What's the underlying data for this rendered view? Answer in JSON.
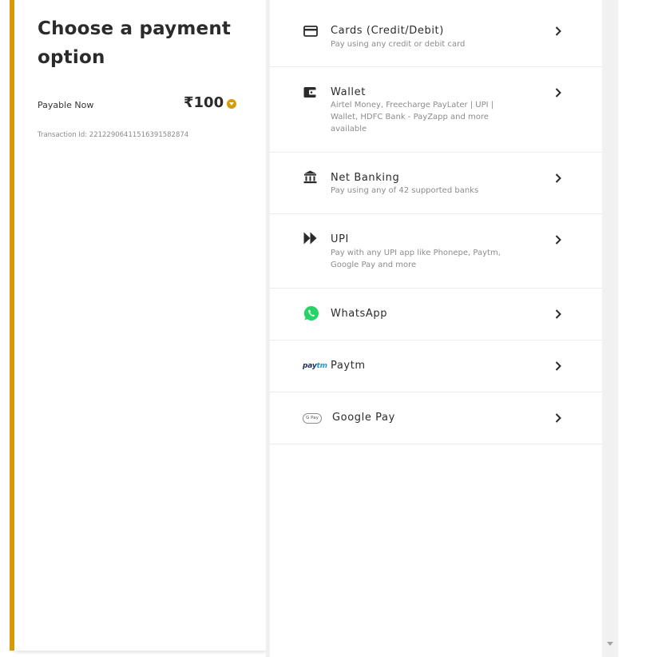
{
  "summary": {
    "title": "Choose a payment option",
    "payable_label": "Payable Now",
    "amount": "₹100",
    "transaction_id": "Transaction Id: 22122906411516391582874",
    "accent_color": "#d99a0a"
  },
  "options": [
    {
      "id": "cards",
      "title": "Cards (Credit/Debit)",
      "subtitle": "Pay using any credit or debit card",
      "icon": "credit-card-icon"
    },
    {
      "id": "wallet",
      "title": "Wallet",
      "subtitle": "Airtel Money, Freecharge PayLater | UPI | Wallet, HDFC Bank - PayZapp and more available",
      "icon": "wallet-icon"
    },
    {
      "id": "net-banking",
      "title": "Net Banking",
      "subtitle": "Pay using any of 42 supported banks",
      "icon": "bank-icon"
    },
    {
      "id": "upi",
      "title": "UPI",
      "subtitle": "Pay with any UPI app like Phonepe, Paytm, Google Pay and more",
      "icon": "upi-icon"
    },
    {
      "id": "whatsapp",
      "title": "WhatsApp",
      "subtitle": "",
      "icon": "whatsapp-icon"
    },
    {
      "id": "paytm",
      "title": "Paytm",
      "subtitle": "",
      "icon": "paytm-logo-icon",
      "logo_text": "paytm"
    },
    {
      "id": "google-pay",
      "title": "Google Pay",
      "subtitle": "",
      "icon": "google-pay-logo-icon",
      "logo_text": "G Pay"
    }
  ]
}
